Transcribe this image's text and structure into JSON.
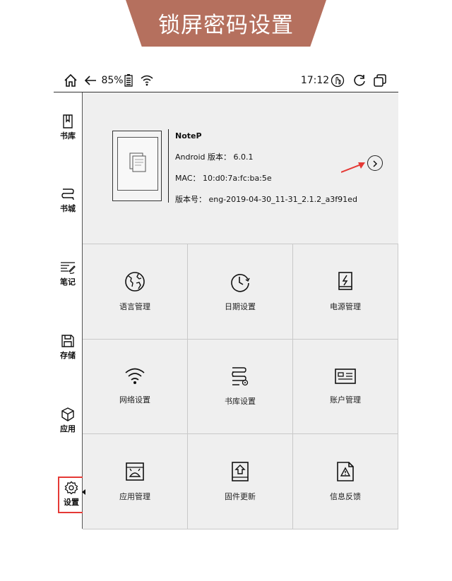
{
  "banner": {
    "title": "锁屏密码设置"
  },
  "statusbar": {
    "battery": "85%",
    "time": "17:12",
    "icons": [
      "home-icon",
      "back-arrow-icon",
      "battery-icon",
      "wifi-icon",
      "touch-icon",
      "refresh-icon",
      "window-icon"
    ]
  },
  "sidebar": {
    "items": [
      {
        "label": "书库",
        "icon": "book-icon"
      },
      {
        "label": "书城",
        "icon": "bookshelf-icon"
      },
      {
        "label": "笔记",
        "icon": "notes-icon"
      },
      {
        "label": "存储",
        "icon": "storage-icon"
      },
      {
        "label": "应用",
        "icon": "cube-icon"
      },
      {
        "label": "设置",
        "icon": "gear-icon",
        "active": true
      }
    ]
  },
  "device_info": {
    "name": "NoteP",
    "android_version": "Android 版本： 6.0.1",
    "mac": "MAC： 10:d0:7a:fc:ba:5e",
    "build": "版本号： eng-2019-04-30_11-31_2.1.2_a3f91ed"
  },
  "grid": {
    "items": [
      {
        "label": "语言管理",
        "icon": "globe-icon"
      },
      {
        "label": "日期设置",
        "icon": "clock-icon"
      },
      {
        "label": "电源管理",
        "icon": "power-icon"
      },
      {
        "label": "网络设置",
        "icon": "wifi-icon"
      },
      {
        "label": "书库设置",
        "icon": "library-settings-icon"
      },
      {
        "label": "账户管理",
        "icon": "account-card-icon"
      },
      {
        "label": "应用管理",
        "icon": "android-app-icon"
      },
      {
        "label": "固件更新",
        "icon": "firmware-update-icon"
      },
      {
        "label": "信息反馈",
        "icon": "feedback-warning-icon"
      }
    ]
  },
  "colors": {
    "banner": "#b5705e",
    "highlight": "#e53935",
    "panel": "#efefef"
  }
}
